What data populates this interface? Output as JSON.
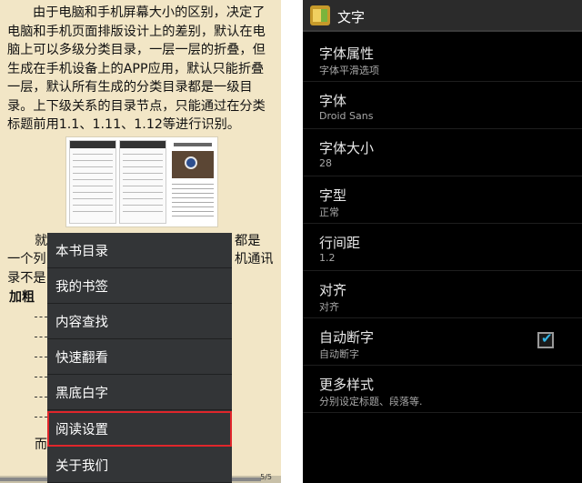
{
  "reader": {
    "para1": "由于电脑和手机屏幕大小的区别，决定了电脑和手机页面排版设计上的差别，默认在电脑上可以多级分类目录，一层一层的折叠，但生成在手机设备上的APP应用，默认只能折叠一层，默认所有生成的分类目录都是一级目录。上下级关系的目录节点，只能通过在分类标题前用1.1、1.11、1.12等进行识别。",
    "line2_left": "就",
    "line2_right": "都是",
    "line3_left": "一个列",
    "line3_right": "机通讯",
    "line4_left": "录不是",
    "line4_right": "",
    "bold_word": "加粗",
    "remainder": "而",
    "page_indicator": "5/5",
    "progress": 0.93
  },
  "menu": {
    "items": [
      "本书目录",
      "我的书签",
      "内容查找",
      "快速翻看",
      "黑底白字",
      "阅读设置",
      "关于我们"
    ],
    "selected_index": 5,
    "highlight_color": "#e0262b"
  },
  "settings": {
    "title": "文字",
    "rows": [
      {
        "title": "字体属性",
        "subtitle": "字体平滑选项"
      },
      {
        "title": "字体",
        "subtitle": "Droid Sans"
      },
      {
        "title": "字体大小",
        "subtitle": "28"
      },
      {
        "title": "字型",
        "subtitle": "正常"
      },
      {
        "title": "行间距",
        "subtitle": "1.2"
      },
      {
        "title": "对齐",
        "subtitle": "对齐"
      },
      {
        "title": "自动断字",
        "subtitle": "自动断字"
      },
      {
        "title": "更多样式",
        "subtitle": "分别设定标题、段落等."
      }
    ],
    "auto_hyphen_checked": true,
    "check_color": "#33b5e5"
  }
}
